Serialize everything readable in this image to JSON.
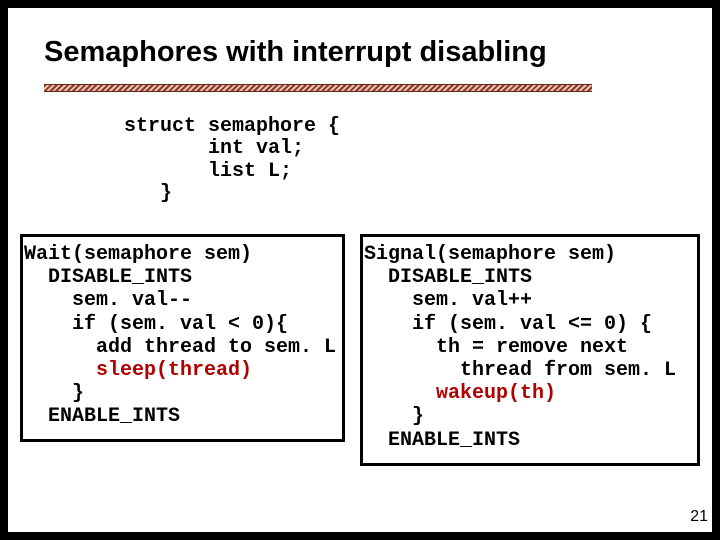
{
  "title": "Semaphores with interrupt disabling",
  "struct": {
    "l1": "struct semaphore {",
    "l2": "       int val;",
    "l3": "       list L;",
    "l4": "   }"
  },
  "wait": {
    "l1": "Wait(semaphore sem)",
    "l2": "  DISABLE_INTS",
    "l3": "    sem. val--",
    "l4": "    if (sem. val < 0){",
    "l5": "      add thread to sem. L",
    "l6_red": "      sleep(thread)",
    "l7": "    }",
    "l8": "  ENABLE_INTS"
  },
  "signal": {
    "l1": "Signal(semaphore sem)",
    "l2": "  DISABLE_INTS",
    "l3": "    sem. val++",
    "l4": "    if (sem. val <= 0) {",
    "l5": "      th = remove next",
    "l6": "        thread from sem. L",
    "l7_red": "      wakeup(th)",
    "l8": "    }",
    "l9": "  ENABLE_INTS"
  },
  "pagenum": "21"
}
